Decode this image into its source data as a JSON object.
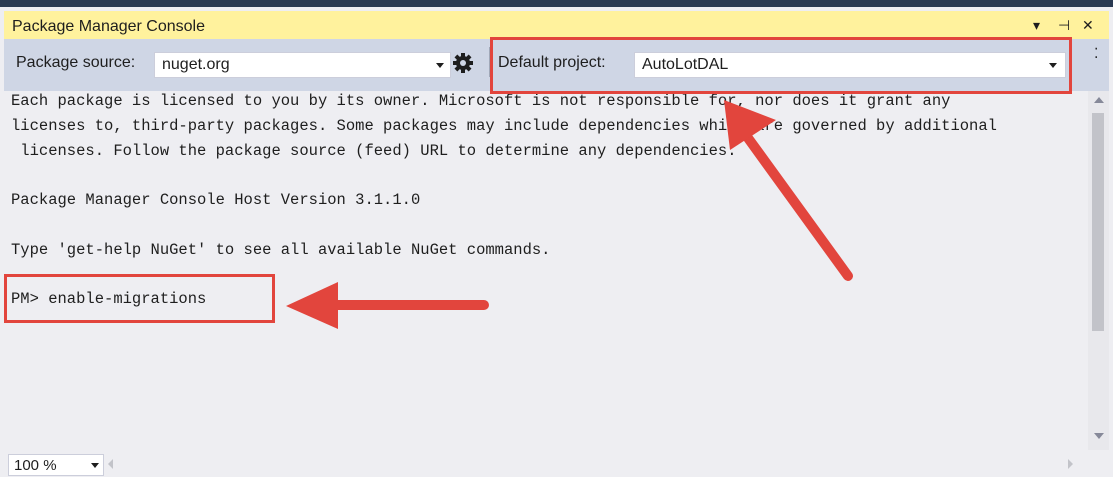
{
  "panel": {
    "title": "Package Manager Console",
    "dropdown_glyph": "▾",
    "pin_glyph": "⊣",
    "close_glyph": "✕"
  },
  "toolbar": {
    "package_source_label": "Package source:",
    "package_source_value": "nuget.org",
    "settings_icon": "gear-icon",
    "default_project_label": "Default project:",
    "default_project_value": "AutoLotDAL",
    "overflow_glyph": "⁚"
  },
  "console": {
    "lines": [
      "Each package is licensed to you by its owner. Microsoft is not responsible for, nor does it grant any",
      "licenses to, third-party packages. Some packages may include dependencies which are governed by additional",
      " licenses. Follow the package source (feed) URL to determine any dependencies.",
      "Package Manager Console Host Version 3.1.1.0",
      "Type 'get-help NuGet' to see all available NuGet commands.",
      "PM> enable-migrations"
    ]
  },
  "footer": {
    "zoom_value": "100 %"
  },
  "colors": {
    "annotation": "#e2453d",
    "title_bar": "#fff29d",
    "toolbar": "#cfd6e5",
    "console_bg": "#eeeef2"
  }
}
